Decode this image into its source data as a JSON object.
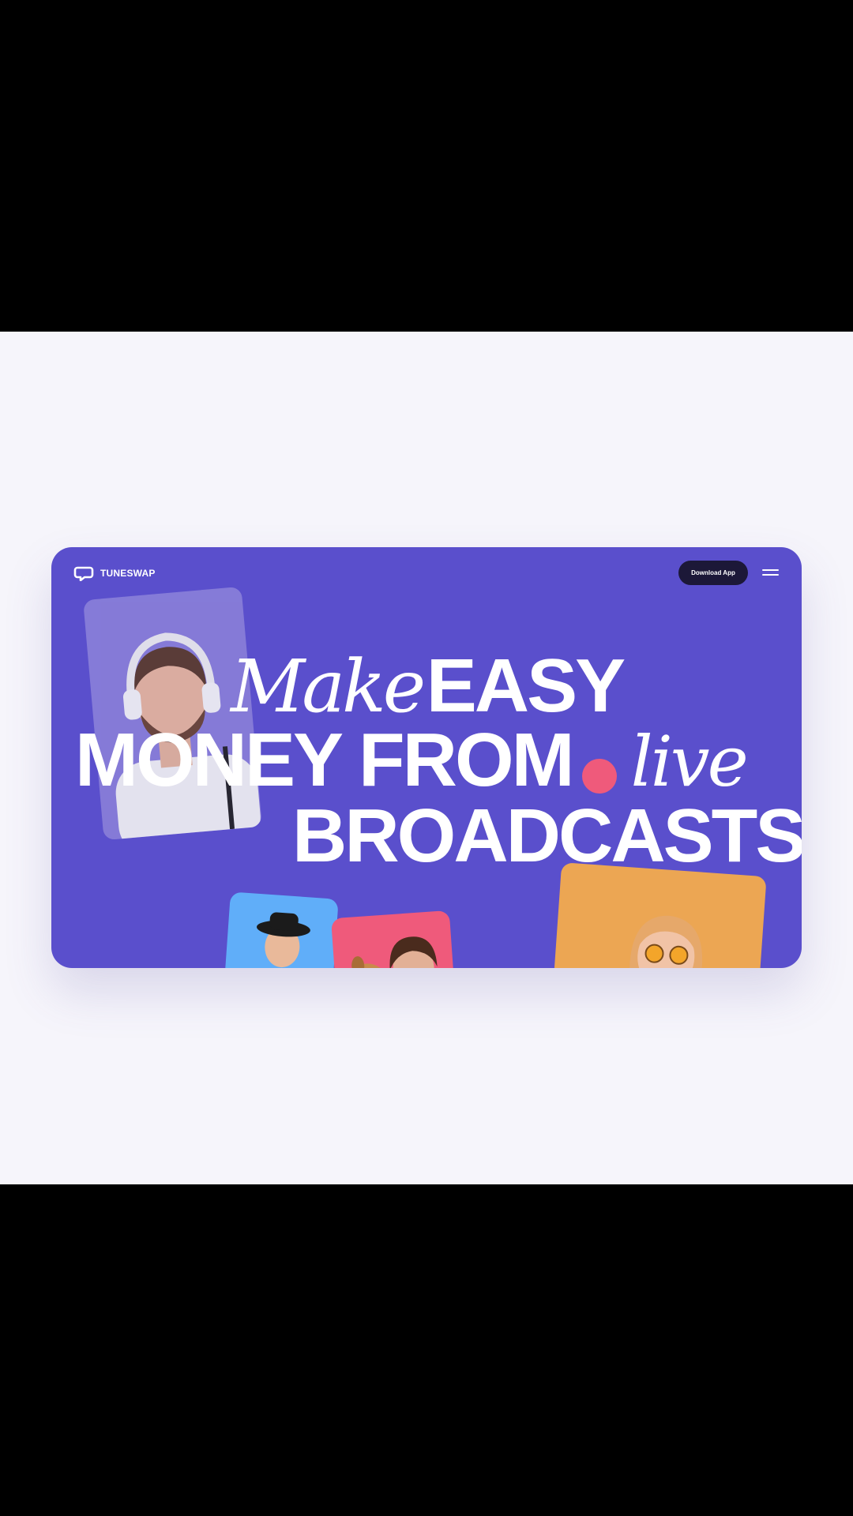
{
  "brand": {
    "name": "TUNESWAP"
  },
  "header": {
    "download_label": "Download App"
  },
  "hero": {
    "line1_script": "Make",
    "line1_bold": "EASY",
    "line2_bold": "MONEY FROM",
    "line2_script": "live",
    "line3_bold": "BROADCASTS"
  },
  "colors": {
    "card_bg": "#5a4fcc",
    "accent_dot": "#ef5a7b",
    "button_bg": "#1c1838",
    "tile_blue": "#60aef9",
    "tile_pink": "#ef5a7b",
    "tile_orange": "#eca653"
  },
  "icons": {
    "logo": "tuneswap-logo-icon",
    "menu": "hamburger-menu-icon"
  }
}
